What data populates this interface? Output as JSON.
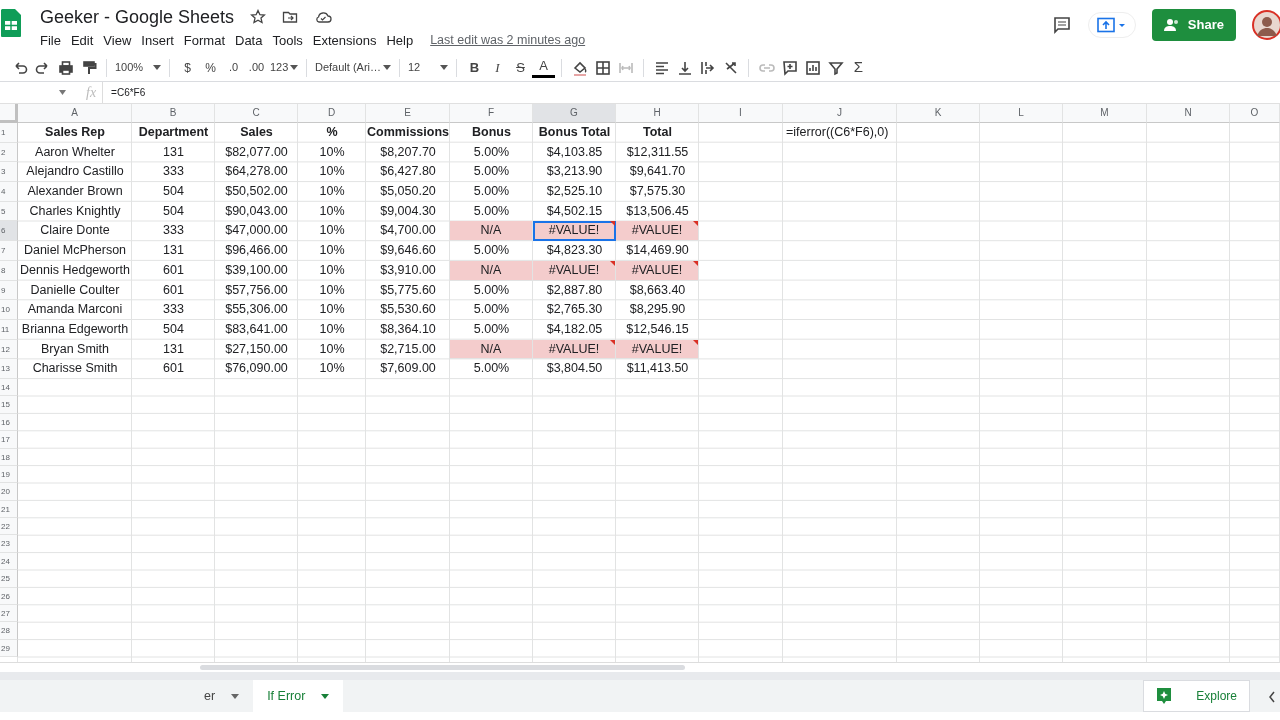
{
  "window": {
    "title": "Geeker - Google Sheets"
  },
  "menu": [
    "File",
    "Edit",
    "View",
    "Insert",
    "Format",
    "Data",
    "Tools",
    "Extensions",
    "Help"
  ],
  "last_edit": "Last edit was 2 minutes ago",
  "share_button": "Share",
  "toolbar": {
    "zoom": "100%",
    "currency": "$",
    "percent": "%",
    "decrease_decimals": ".0",
    "increase_decimals": ".00",
    "more_formats": "123",
    "font": "Default (Ari…",
    "font_size": "12",
    "bold": "B",
    "italic": "I",
    "strikethrough": "S",
    "text_color": "A",
    "functions": "Σ"
  },
  "formula_bar": {
    "fx": "fx",
    "formula": "=C6*F6"
  },
  "columns": [
    {
      "label": "A",
      "selected": false
    },
    {
      "label": "B",
      "selected": false
    },
    {
      "label": "C",
      "selected": false
    },
    {
      "label": "D",
      "selected": false
    },
    {
      "label": "E",
      "selected": false
    },
    {
      "label": "F",
      "selected": false
    },
    {
      "label": "G",
      "selected": true
    },
    {
      "label": "H",
      "selected": false
    },
    {
      "label": "I",
      "selected": false
    },
    {
      "label": "J",
      "selected": false
    },
    {
      "label": "K",
      "selected": false
    },
    {
      "label": "L",
      "selected": false
    },
    {
      "label": "M",
      "selected": false
    },
    {
      "label": "N",
      "selected": false
    },
    {
      "label": "O",
      "selected": false
    }
  ],
  "rows": [
    {
      "number": "1",
      "selected": false,
      "error": false,
      "header": true,
      "cells": [
        "Sales Rep",
        "Department",
        "Sales",
        "%",
        "Commissions",
        "Bonus",
        "Bonus Total",
        "Total"
      ],
      "column_j": "=iferror((C6*F6),0)"
    },
    {
      "number": "2",
      "selected": false,
      "error": false,
      "cells": [
        "Aaron Whelter",
        "131",
        "$82,077.00",
        "10%",
        "$8,207.70",
        "5.00%",
        "$4,103.85",
        "$12,311.55"
      ]
    },
    {
      "number": "3",
      "selected": false,
      "error": false,
      "cells": [
        "Alejandro Castillo",
        "333",
        "$64,278.00",
        "10%",
        "$6,427.80",
        "5.00%",
        "$3,213.90",
        "$9,641.70"
      ]
    },
    {
      "number": "4",
      "selected": false,
      "error": false,
      "cells": [
        "Alexander Brown",
        "504",
        "$50,502.00",
        "10%",
        "$5,050.20",
        "5.00%",
        "$2,525.10",
        "$7,575.30"
      ]
    },
    {
      "number": "5",
      "selected": false,
      "error": false,
      "cells": [
        "Charles Knightly",
        "504",
        "$90,043.00",
        "10%",
        "$9,004.30",
        "5.00%",
        "$4,502.15",
        "$13,506.45"
      ]
    },
    {
      "number": "6",
      "selected": true,
      "error": true,
      "cells": [
        "Claire Donte",
        "333",
        "$47,000.00",
        "10%",
        "$4,700.00",
        "N/A",
        "#VALUE!",
        "#VALUE!"
      ]
    },
    {
      "number": "7",
      "selected": false,
      "error": false,
      "cells": [
        "Daniel McPherson",
        "131",
        "$96,466.00",
        "10%",
        "$9,646.60",
        "5.00%",
        "$4,823.30",
        "$14,469.90"
      ]
    },
    {
      "number": "8",
      "selected": false,
      "error": true,
      "cells": [
        "Dennis Hedgeworth",
        "601",
        "$39,100.00",
        "10%",
        "$3,910.00",
        "N/A",
        "#VALUE!",
        "#VALUE!"
      ]
    },
    {
      "number": "9",
      "selected": false,
      "error": false,
      "cells": [
        "Danielle Coulter",
        "601",
        "$57,756.00",
        "10%",
        "$5,775.60",
        "5.00%",
        "$2,887.80",
        "$8,663.40"
      ]
    },
    {
      "number": "10",
      "selected": false,
      "error": false,
      "cells": [
        "Amanda Marconi",
        "333",
        "$55,306.00",
        "10%",
        "$5,530.60",
        "5.00%",
        "$2,765.30",
        "$8,295.90"
      ]
    },
    {
      "number": "11",
      "selected": false,
      "error": false,
      "cells": [
        "Brianna Edgeworth",
        "504",
        "$83,641.00",
        "10%",
        "$8,364.10",
        "5.00%",
        "$4,182.05",
        "$12,546.15"
      ]
    },
    {
      "number": "12",
      "selected": false,
      "error": true,
      "cells": [
        "Bryan Smith",
        "131",
        "$27,150.00",
        "10%",
        "$2,715.00",
        "N/A",
        "#VALUE!",
        "#VALUE!"
      ]
    },
    {
      "number": "13",
      "selected": false,
      "error": false,
      "cells": [
        "Charisse Smith",
        "601",
        "$76,090.00",
        "10%",
        "$7,609.00",
        "5.00%",
        "$3,804.50",
        "$11,413.50"
      ]
    },
    {
      "number": "14",
      "selected": false,
      "error": false,
      "cells": []
    },
    {
      "number": "15",
      "selected": false,
      "error": false,
      "cells": []
    },
    {
      "number": "16",
      "selected": false,
      "error": false,
      "cells": []
    },
    {
      "number": "17",
      "selected": false,
      "error": false,
      "cells": []
    },
    {
      "number": "18",
      "selected": false,
      "error": false,
      "cells": []
    },
    {
      "number": "19",
      "selected": false,
      "error": false,
      "cells": []
    },
    {
      "number": "20",
      "selected": false,
      "error": false,
      "cells": []
    },
    {
      "number": "21",
      "selected": false,
      "error": false,
      "cells": []
    },
    {
      "number": "22",
      "selected": false,
      "error": false,
      "cells": []
    },
    {
      "number": "23",
      "selected": false,
      "error": false,
      "cells": []
    },
    {
      "number": "24",
      "selected": false,
      "error": false,
      "cells": []
    },
    {
      "number": "25",
      "selected": false,
      "error": false,
      "cells": []
    },
    {
      "number": "26",
      "selected": false,
      "error": false,
      "cells": []
    },
    {
      "number": "27",
      "selected": false,
      "error": false,
      "cells": []
    },
    {
      "number": "28",
      "selected": false,
      "error": false,
      "cells": []
    },
    {
      "number": "29",
      "selected": false,
      "error": false,
      "cells": []
    }
  ],
  "sheet_tabs": [
    {
      "label": "er",
      "selected": false
    },
    {
      "label": "If Error",
      "selected": true
    }
  ],
  "explore_button": "Explore"
}
